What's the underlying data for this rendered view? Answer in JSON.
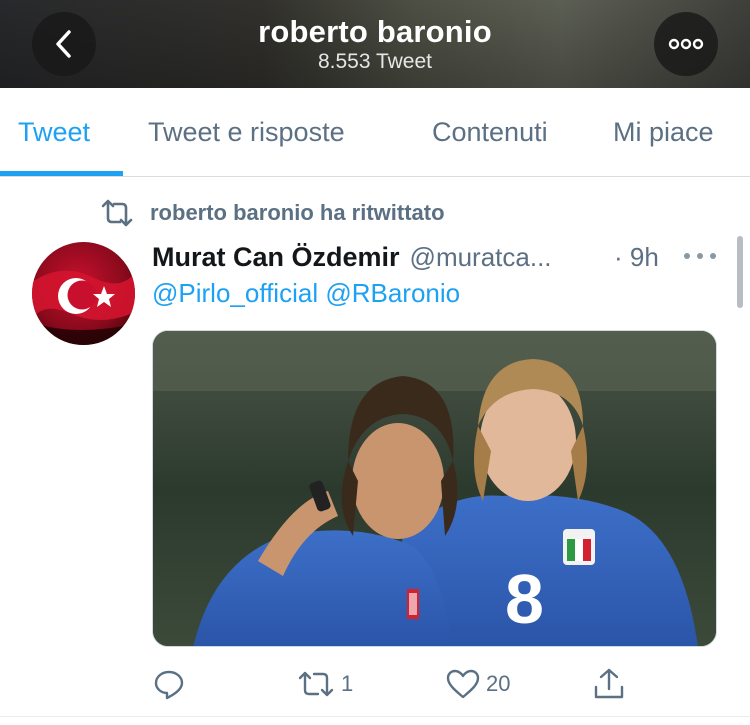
{
  "header": {
    "title": "roberto baronio",
    "subtitle": "8.553 Tweet",
    "back_icon": "chevron-left-icon",
    "more_icon": "more-icon"
  },
  "tabs": [
    {
      "label": "Tweet",
      "active": true
    },
    {
      "label": "Tweet e risposte",
      "active": false
    },
    {
      "label": "Contenuti",
      "active": false
    },
    {
      "label": "Mi piace",
      "active": false
    }
  ],
  "tweet": {
    "retweet_context": "roberto baronio ha ritwittato",
    "author_name": "Murat Can Özdemir",
    "author_handle": "@muratca...",
    "time": "· 9h",
    "mentions": [
      "@Pirlo_official",
      "@RBaronio"
    ],
    "actions": {
      "reply_count": "",
      "retweet_count": "1",
      "like_count": "20"
    }
  },
  "colors": {
    "accent": "#1da1f2",
    "secondary_text": "#5b7083"
  }
}
